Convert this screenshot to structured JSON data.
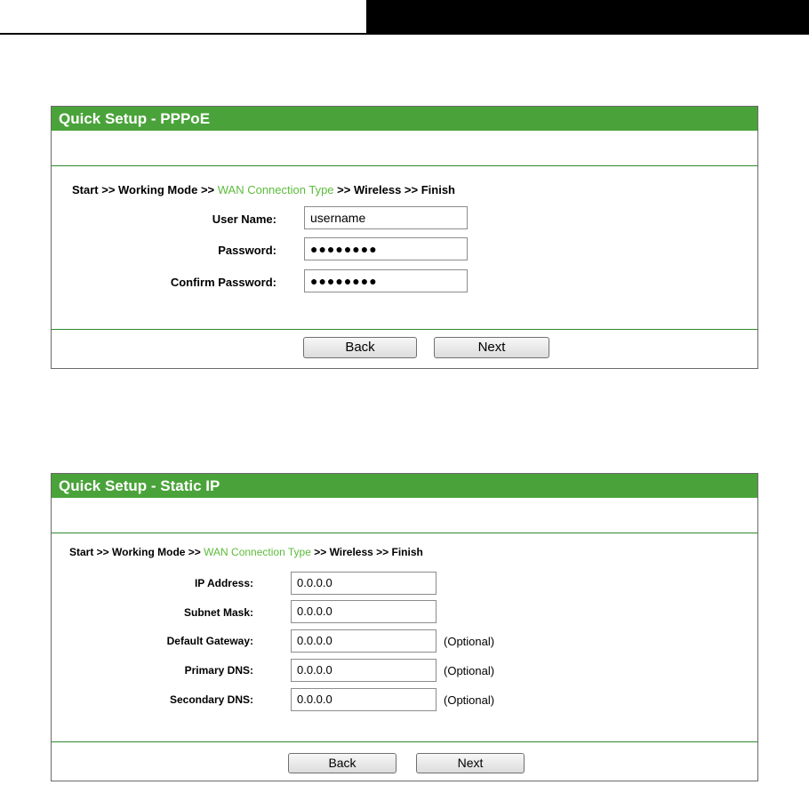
{
  "pppoe": {
    "title": "Quick Setup - PPPoE",
    "steps": {
      "start": "Start >> Working Mode >> ",
      "active": "WAN Connection Type",
      "end": " >> Wireless >> Finish"
    },
    "fields": [
      {
        "label": "User Name:",
        "value": "username"
      },
      {
        "label": "Password:",
        "value": "●●●●●●●●"
      },
      {
        "label": "Confirm Password:",
        "value": "●●●●●●●●"
      }
    ],
    "buttons": {
      "back": "Back",
      "next": "Next"
    }
  },
  "static_ip": {
    "title": "Quick Setup - Static IP",
    "steps": {
      "start": "Start >> Working Mode >> ",
      "active": "WAN Connection Type",
      "end": " >> Wireless >> Finish"
    },
    "fields": [
      {
        "label": "IP Address:",
        "value": "0.0.0.0",
        "note": ""
      },
      {
        "label": "Subnet Mask:",
        "value": "0.0.0.0",
        "note": ""
      },
      {
        "label": "Default Gateway:",
        "value": "0.0.0.0",
        "note": "(Optional)"
      },
      {
        "label": "Primary DNS:",
        "value": "0.0.0.0",
        "note": "(Optional)"
      },
      {
        "label": "Secondary DNS:",
        "value": "0.0.0.0",
        "note": "(Optional)"
      }
    ],
    "buttons": {
      "back": "Back",
      "next": "Next"
    }
  }
}
